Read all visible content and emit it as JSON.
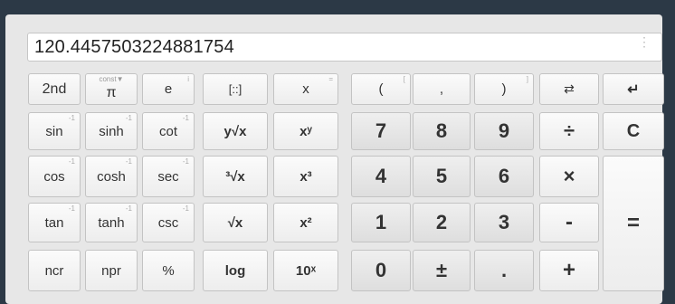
{
  "display": {
    "value": "120.4457503224881754"
  },
  "keys": {
    "second": "2nd",
    "const_sup": "const▼",
    "pi": "π",
    "e": "e",
    "e_sup": "i",
    "matrix": "[::]",
    "x": "x",
    "x_sup": "=",
    "paren_open": "(",
    "paren_open_sup": "[",
    "comma": ",",
    "paren_close": ")",
    "paren_close_sup": "]",
    "swap": "⇄",
    "backspace": "↵",
    "sin": "sin",
    "sinh": "sinh",
    "cot": "cot",
    "yroot": "y√x",
    "xpowy": "xʸ",
    "cos": "cos",
    "cosh": "cosh",
    "sec": "sec",
    "cuberoot": "³√x",
    "xcube": "x³",
    "tan": "tan",
    "tanh": "tanh",
    "csc": "csc",
    "sqrt": "√x",
    "xsq": "x²",
    "ncr": "ncr",
    "npr": "npr",
    "percent": "%",
    "log": "log",
    "tenpow": "10ˣ",
    "inv_sup": "-1",
    "n7": "7",
    "n8": "8",
    "n9": "9",
    "divide": "÷",
    "clear": "C",
    "n4": "4",
    "n5": "5",
    "n6": "6",
    "multiply": "×",
    "n1": "1",
    "n2": "2",
    "n3": "3",
    "minus": "-",
    "equals": "=",
    "n0": "0",
    "plusminus": "±",
    "dot": ".",
    "plus": "+"
  }
}
